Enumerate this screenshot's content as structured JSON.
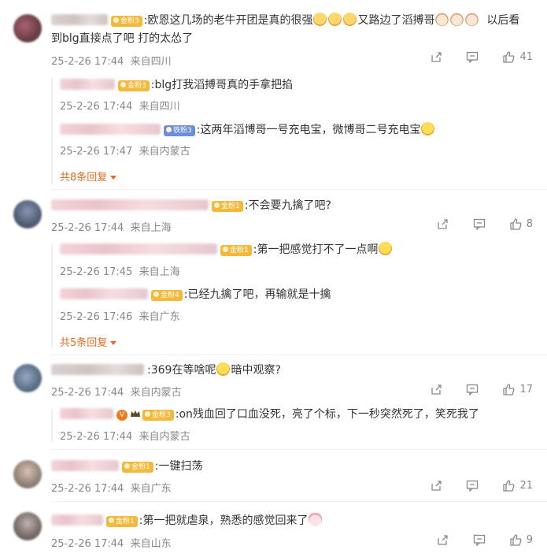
{
  "comments": [
    {
      "badge": "金粉3",
      "text_line1": ":欧恩这几场的老牛开团是真的很强",
      "text_line1b": "又路边了滔搏哥",
      "text_line1c": "以后看",
      "text_line2": "到blg直接点了吧  打的太怂了",
      "time": "25-2-26 17:44",
      "loc": "来自四川",
      "likes": "41",
      "replies": [
        {
          "badge": "金粉3",
          "text": ":blg打我滔搏哥真的手拿把掐",
          "time": "25-2-26 17:44",
          "loc": "来自四川"
        },
        {
          "badge": "铁粉3",
          "text": ":这两年滔博哥一号充电宝，微博哥二号充电宝",
          "time": "25-2-26 17:47",
          "loc": "来自内蒙古"
        }
      ],
      "more": "共8条回复"
    },
    {
      "badge": "金粉1",
      "text": ":不会要九擒了吧?",
      "time": "25-2-26 17:44",
      "loc": "来自上海",
      "likes": "8",
      "replies": [
        {
          "badge": "金粉1",
          "text": ":第一把感觉打不了一点啊",
          "time": "25-2-26 17:45",
          "loc": "来自上海"
        },
        {
          "badge": "金粉4",
          "text": ":已经九擒了吧，再输就是十擒",
          "time": "25-2-26 17:46",
          "loc": "来自广东"
        }
      ],
      "more": "共5条回复"
    },
    {
      "text_a": ":369在等啥呢",
      "text_b": "暗中观察?",
      "time": "25-2-26 17:44",
      "loc": "来自内蒙古",
      "likes": "17",
      "replies": [
        {
          "badge": "金粉3",
          "text": ":on残血回了口血没死，亮了个标，下一秒突然死了，笑死我了",
          "time": "25-2-26 17:44",
          "loc": "来自内蒙古"
        }
      ]
    },
    {
      "badge": "金粉1",
      "text": ":一键扫荡",
      "time": "25-2-26 17:44",
      "loc": "来自广东",
      "likes": "21"
    },
    {
      "badge": "金粉1",
      "text": ":第一把就虐泉，熟悉的感觉回来了",
      "time": "25-2-26 17:44",
      "loc": "来自山东",
      "likes": "9"
    }
  ],
  "icons": {
    "share": "share-icon",
    "comment": "comment-icon",
    "like": "like-icon"
  },
  "colors": {
    "more_link": "#e06c22",
    "badge_gold": "#f4b93a",
    "badge_iron": "#6b8fd8",
    "meta": "#888888"
  }
}
